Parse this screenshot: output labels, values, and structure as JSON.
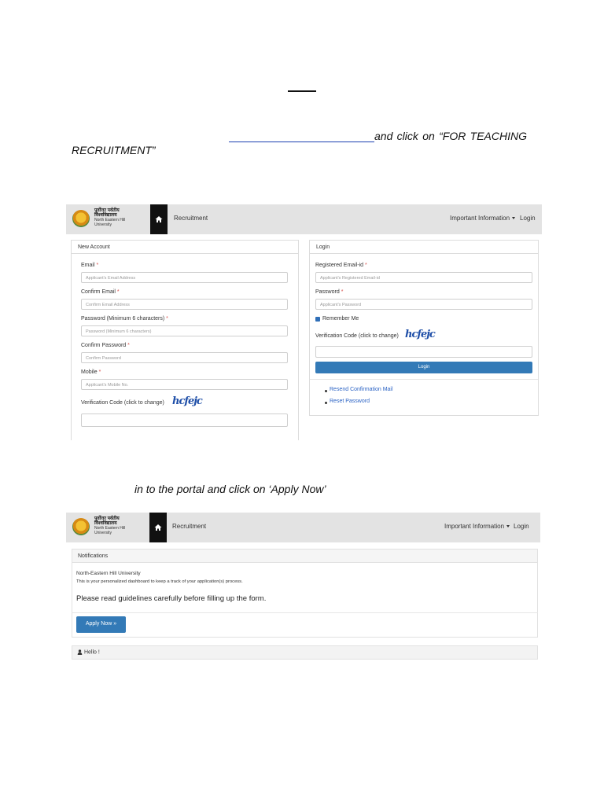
{
  "document": {
    "instruction_1": "and click on “FOR TEACHING",
    "instruction_1_cont": "RECRUITMENT”",
    "instruction_2": "in to the portal and click on ‘Apply Now’"
  },
  "portal": {
    "logo": {
      "hindi_line1": "पूर्वोत्तर पर्वतीय",
      "hindi_line2": "विश्वविद्यालय",
      "eng_line1": "North Eastern Hill",
      "eng_line2": "University"
    },
    "nav": {
      "recruitment": "Recruitment",
      "important_information": "Important Information",
      "login": "Login"
    }
  },
  "new_account": {
    "heading": "New Account",
    "email_label": "Email",
    "email_placeholder": "Applicant's Email Address",
    "confirm_email_label": "Confirm Email",
    "confirm_email_placeholder": "Confirm Email Address",
    "password_label": "Password (Minimum 6 characters)",
    "password_placeholder": "Password (Minimum 6 characters)",
    "confirm_password_label": "Confirm Password",
    "confirm_password_placeholder": "Confirm Password",
    "mobile_label": "Mobile",
    "mobile_placeholder": "Applicant's Mobile No.",
    "verification_label": "Verification Code (click to change)",
    "captcha": "hcfejc",
    "required_mark": "*"
  },
  "login_panel": {
    "heading": "Login",
    "email_label": "Registered Email-id",
    "email_placeholder": "Applicant's Registered Email-id",
    "password_label": "Password",
    "password_placeholder": "Applicant's Password",
    "remember_me": "Remember Me",
    "verification_label": "Verification Code (click to change)",
    "captcha": "hcfejc",
    "login_button": "Login",
    "resend_link": "Resend Confirmation Mail",
    "reset_link": "Reset Password"
  },
  "dashboard": {
    "notifications_heading": "Notifications",
    "university": "North-Eastern Hill University",
    "description": "This is your personalized dashboard to keep a track of your application(s) process.",
    "guideline": "Please read guidelines carefully before filling up the form.",
    "apply_button": "Apply Now",
    "apply_arrow": "»",
    "hello": "Hello !"
  },
  "colors": {
    "primary": "#337ab7",
    "navbar": "#e3e3e3",
    "link": "#2a62c4"
  }
}
